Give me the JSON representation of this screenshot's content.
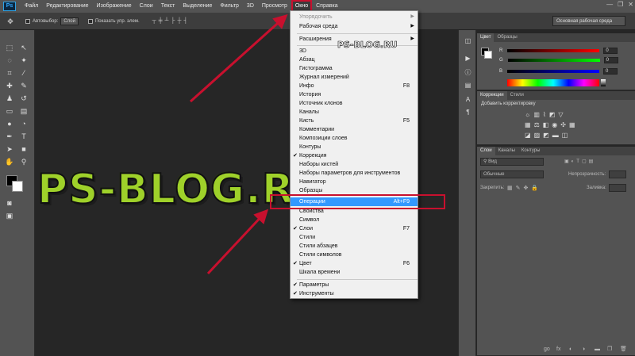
{
  "menubar": {
    "logo": "Ps",
    "items": [
      "Файл",
      "Редактирование",
      "Изображение",
      "Слои",
      "Текст",
      "Выделение",
      "Фильтр",
      "3D",
      "Просмотр",
      "Окно",
      "Справка"
    ],
    "active": "Окно",
    "window_controls": [
      "—",
      "❐",
      "✕"
    ]
  },
  "options_bar": {
    "autoselect_label": "Автовыбор:",
    "autoselect_value": "Слой",
    "show_transform_label": "Показать упр. элем.",
    "workspace_value": "Основная рабочая среда"
  },
  "dropdown": {
    "items": [
      {
        "label": "Упорядочить",
        "disabled": true,
        "submenu": true
      },
      {
        "label": "Рабочая среда",
        "submenu": true
      },
      {
        "label": "Расширения",
        "submenu": true
      },
      {
        "label": "3D"
      },
      {
        "label": "Абзац"
      },
      {
        "label": "Гистограмма"
      },
      {
        "label": "Журнал измерений"
      },
      {
        "label": "Инфо",
        "shortcut": "F8"
      },
      {
        "label": "История"
      },
      {
        "label": "Источник клонов"
      },
      {
        "label": "Каналы"
      },
      {
        "label": "Кисть",
        "shortcut": "F5"
      },
      {
        "label": "Комментарии"
      },
      {
        "label": "Композиции слоев"
      },
      {
        "label": "Контуры"
      },
      {
        "label": "Коррекция",
        "checked": true
      },
      {
        "label": "Наборы кистей"
      },
      {
        "label": "Наборы параметров для инструментов"
      },
      {
        "label": "Навигатор"
      },
      {
        "label": "Образцы"
      },
      {
        "label": "Операции",
        "shortcut": "Alt+F9",
        "highlight": true
      },
      {
        "label": "Свойства"
      },
      {
        "label": "Символ"
      },
      {
        "label": "Слои",
        "shortcut": "F7",
        "checked": true
      },
      {
        "label": "Стили"
      },
      {
        "label": "Стили абзацев"
      },
      {
        "label": "Стили символов"
      },
      {
        "label": "Цвет",
        "shortcut": "F6",
        "checked": true
      },
      {
        "label": "Шкала времени"
      },
      {
        "label": "Параметры",
        "checked": true
      },
      {
        "label": "Инструменты",
        "checked": true
      }
    ]
  },
  "watermark": {
    "big": "PS-BLOG.RU",
    "small": "PS-BLOG.RU"
  },
  "color_panel": {
    "tabs": [
      "Цвет",
      "Образцы"
    ],
    "channels": [
      {
        "label": "R",
        "value": "0",
        "gradient_to": "#ff0000"
      },
      {
        "label": "G",
        "value": "0",
        "gradient_to": "#00ff00"
      },
      {
        "label": "B",
        "value": "0",
        "gradient_to": "#0000ff"
      }
    ]
  },
  "adjustments_panel": {
    "tabs": [
      "Коррекции",
      "Стили"
    ],
    "title": "Добавить корректировку"
  },
  "layers_panel": {
    "tabs": [
      "Слои",
      "Каналы",
      "Контуры"
    ],
    "kind_value": "Вид",
    "blend_mode": "Обычные",
    "opacity_label": "Непрозрачность:",
    "lock_label": "Закрепить:",
    "fill_label": "Заливка:",
    "bottom_icons": [
      "go",
      "fx",
      "◐",
      "◑",
      "▬",
      "❐",
      "🗑"
    ]
  },
  "colors": {
    "accent_red": "#c8102e",
    "highlight_blue": "#3399ff",
    "watermark_green": "#9fd12a"
  }
}
